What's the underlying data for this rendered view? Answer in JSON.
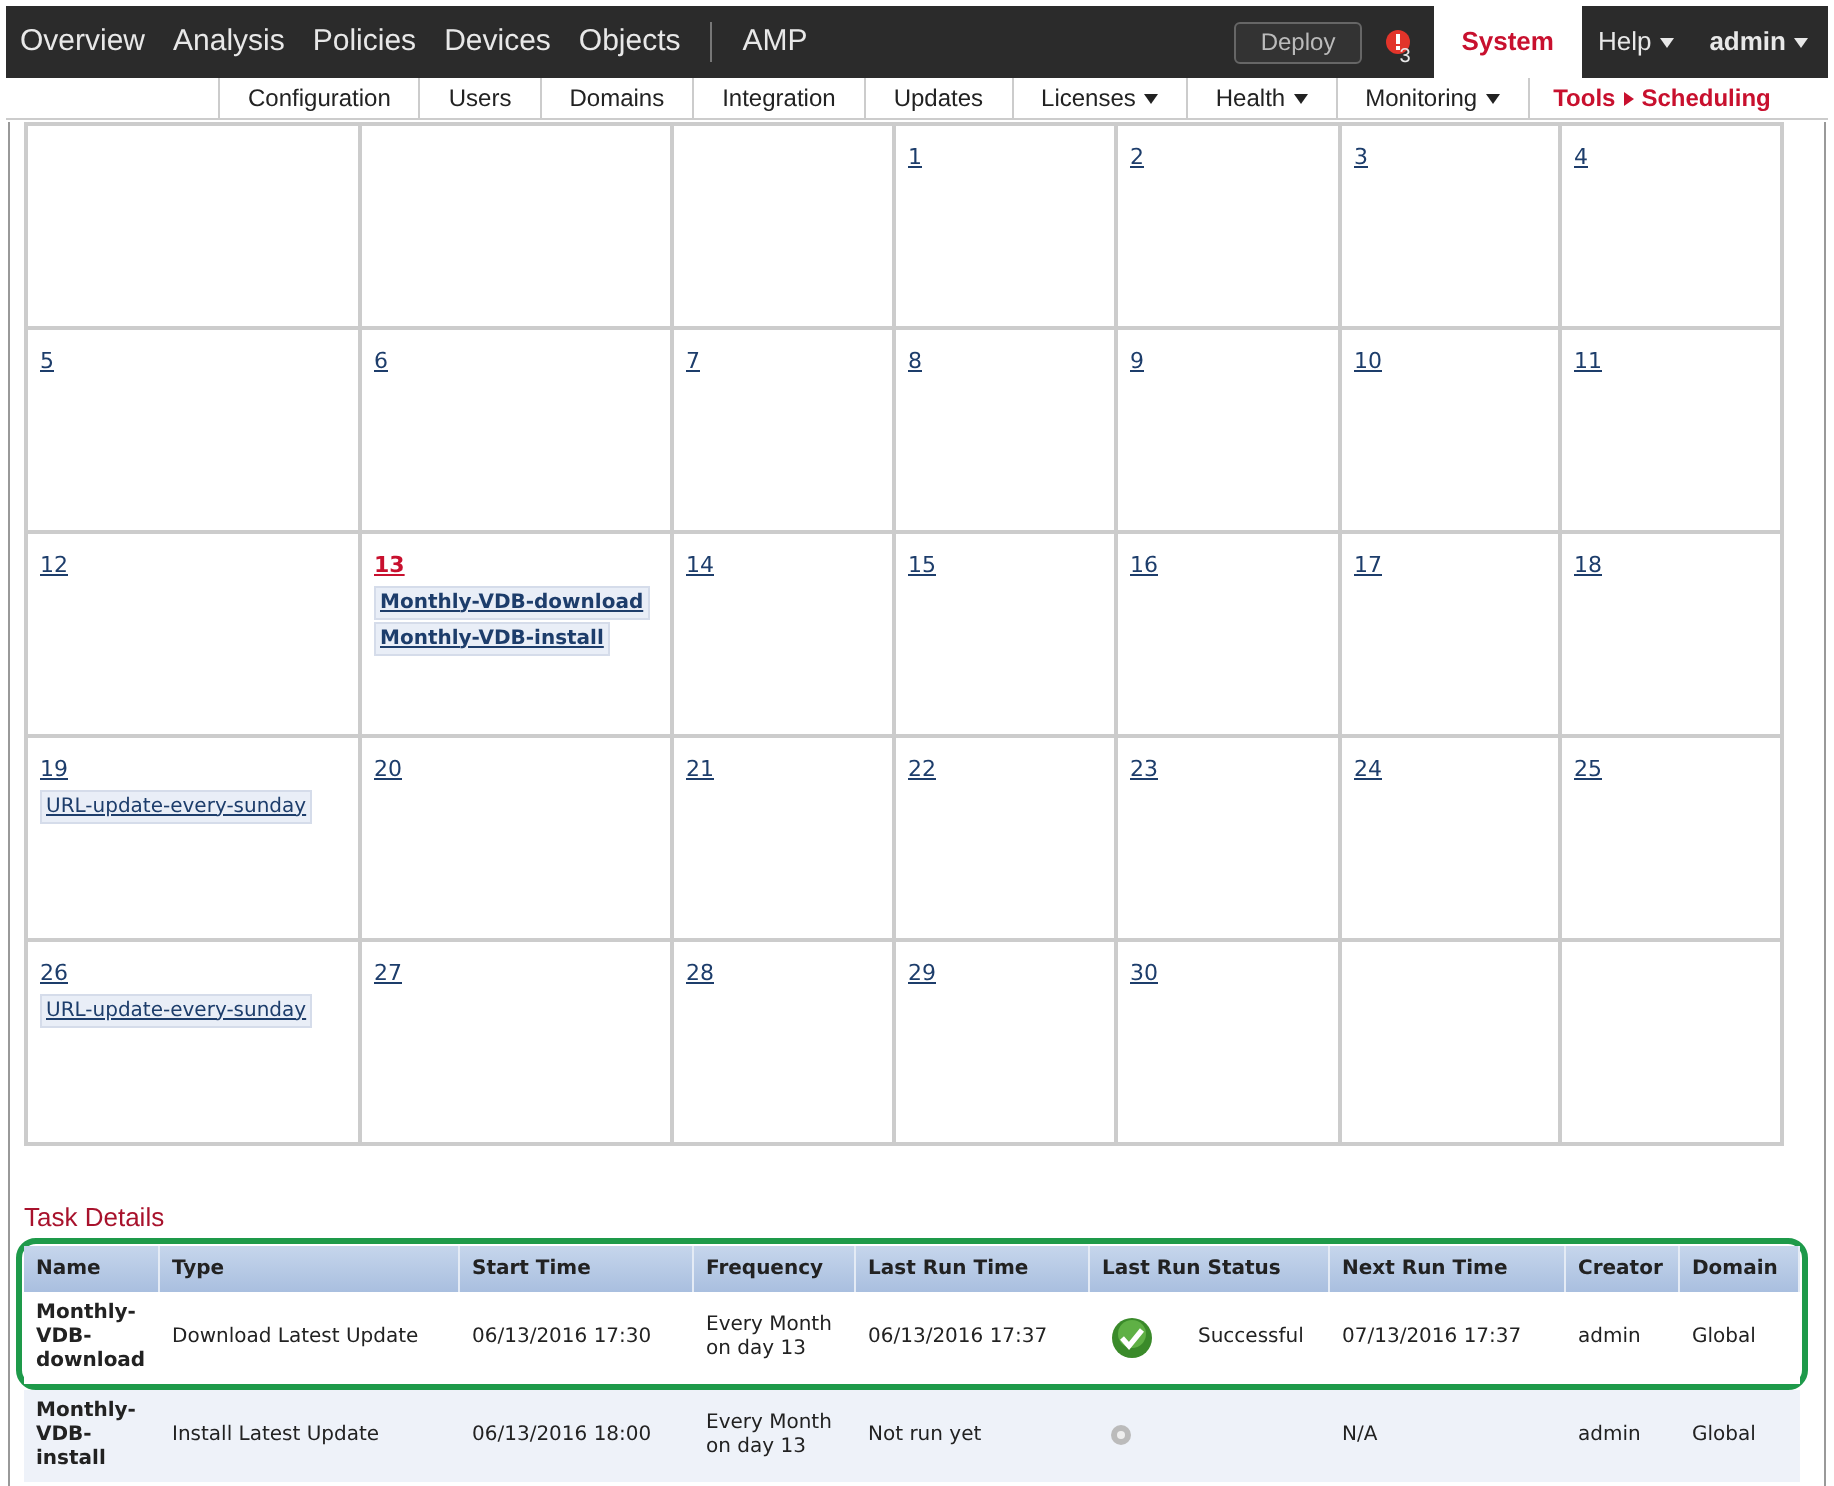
{
  "top_nav": {
    "items": [
      {
        "label": "Overview",
        "selected": false
      },
      {
        "label": "Analysis",
        "selected": false
      },
      {
        "label": "Policies",
        "selected": false
      },
      {
        "label": "Devices",
        "selected": false
      },
      {
        "label": "Objects",
        "selected": false
      },
      {
        "label": "AMP",
        "selected": false
      }
    ],
    "deploy": "Deploy",
    "alert_count": "3",
    "system": {
      "label": "System",
      "selected": true
    },
    "help": "Help",
    "user": "admin"
  },
  "sub_nav": {
    "items": [
      {
        "label": "Configuration",
        "dropdown": false,
        "selected": false
      },
      {
        "label": "Users",
        "dropdown": false,
        "selected": false
      },
      {
        "label": "Domains",
        "dropdown": false,
        "selected": false
      },
      {
        "label": "Integration",
        "dropdown": false,
        "selected": false
      },
      {
        "label": "Updates",
        "dropdown": false,
        "selected": false
      },
      {
        "label": "Licenses",
        "dropdown": true,
        "selected": false
      },
      {
        "label": "Health",
        "dropdown": true,
        "selected": false
      },
      {
        "label": "Monitoring",
        "dropdown": true,
        "selected": false
      }
    ],
    "breadcrumb": [
      "Tools",
      "Scheduling"
    ]
  },
  "calendar": {
    "weeks": [
      [
        {
          "kind": "blank"
        },
        {
          "kind": "blank"
        },
        {
          "kind": "blank"
        },
        {
          "kind": "day",
          "day": "1",
          "today": false
        },
        {
          "kind": "day",
          "day": "2",
          "today": false
        },
        {
          "kind": "day",
          "day": "3",
          "today": false
        },
        {
          "kind": "day",
          "day": "4",
          "today": false
        }
      ],
      [
        {
          "kind": "day",
          "day": "5",
          "today": false
        },
        {
          "kind": "day",
          "day": "6",
          "today": false
        },
        {
          "kind": "day",
          "day": "7",
          "today": false
        },
        {
          "kind": "day",
          "day": "8",
          "today": false
        },
        {
          "kind": "day",
          "day": "9",
          "today": false
        },
        {
          "kind": "day",
          "day": "10",
          "today": false
        },
        {
          "kind": "day",
          "day": "11",
          "today": false
        }
      ],
      [
        {
          "kind": "day",
          "day": "12",
          "today": false
        },
        {
          "kind": "day",
          "day": "13",
          "today": true,
          "events": [
            {
              "label": "Monthly-VDB-download",
              "bold": true
            },
            {
              "label": "Monthly-VDB-install",
              "bold": true
            }
          ]
        },
        {
          "kind": "day",
          "day": "14",
          "today": false
        },
        {
          "kind": "day",
          "day": "15",
          "today": false
        },
        {
          "kind": "day",
          "day": "16",
          "today": false
        },
        {
          "kind": "day",
          "day": "17",
          "today": false
        },
        {
          "kind": "day",
          "day": "18",
          "today": false
        }
      ],
      [
        {
          "kind": "day",
          "day": "19",
          "today": false,
          "events": [
            {
              "label": "URL-update-every-sunday",
              "bold": false
            }
          ]
        },
        {
          "kind": "day",
          "day": "20",
          "today": false
        },
        {
          "kind": "day",
          "day": "21",
          "today": false
        },
        {
          "kind": "day",
          "day": "22",
          "today": false
        },
        {
          "kind": "day",
          "day": "23",
          "today": false
        },
        {
          "kind": "day",
          "day": "24",
          "today": false
        },
        {
          "kind": "day",
          "day": "25",
          "today": false
        }
      ],
      [
        {
          "kind": "day",
          "day": "26",
          "today": false,
          "events": [
            {
              "label": "URL-update-every-sunday",
              "bold": false
            }
          ]
        },
        {
          "kind": "day",
          "day": "27",
          "today": false
        },
        {
          "kind": "day",
          "day": "28",
          "today": false
        },
        {
          "kind": "day",
          "day": "29",
          "today": false
        },
        {
          "kind": "day",
          "day": "30",
          "today": false
        },
        {
          "kind": "blank"
        },
        {
          "kind": "blank"
        }
      ]
    ]
  },
  "task_details": {
    "title": "Task Details",
    "columns": [
      "Name",
      "Type",
      "Start Time",
      "Frequency",
      "Last Run Time",
      "Last Run Status",
      "Next Run Time",
      "Creator",
      "Domain"
    ],
    "rows": [
      {
        "highlighted": true,
        "name": "Monthly-VDB-download",
        "type": "Download Latest Update",
        "start_time": "06/13/2016 17:30",
        "frequency": "Every Month on day 13",
        "last_run_time": "06/13/2016 17:37",
        "status": {
          "kind": "success",
          "label": "Successful"
        },
        "next_run_time": "07/13/2016 17:37",
        "creator": "admin",
        "domain": "Global"
      },
      {
        "highlighted": false,
        "name": "Monthly-VDB-install",
        "type": "Install Latest Update",
        "start_time": "06/13/2016 18:00",
        "frequency": "Every Month on day 13",
        "last_run_time": "Not run yet",
        "status": {
          "kind": "pending"
        },
        "next_run_time": "N/A",
        "creator": "admin",
        "domain": "Global"
      }
    ]
  }
}
